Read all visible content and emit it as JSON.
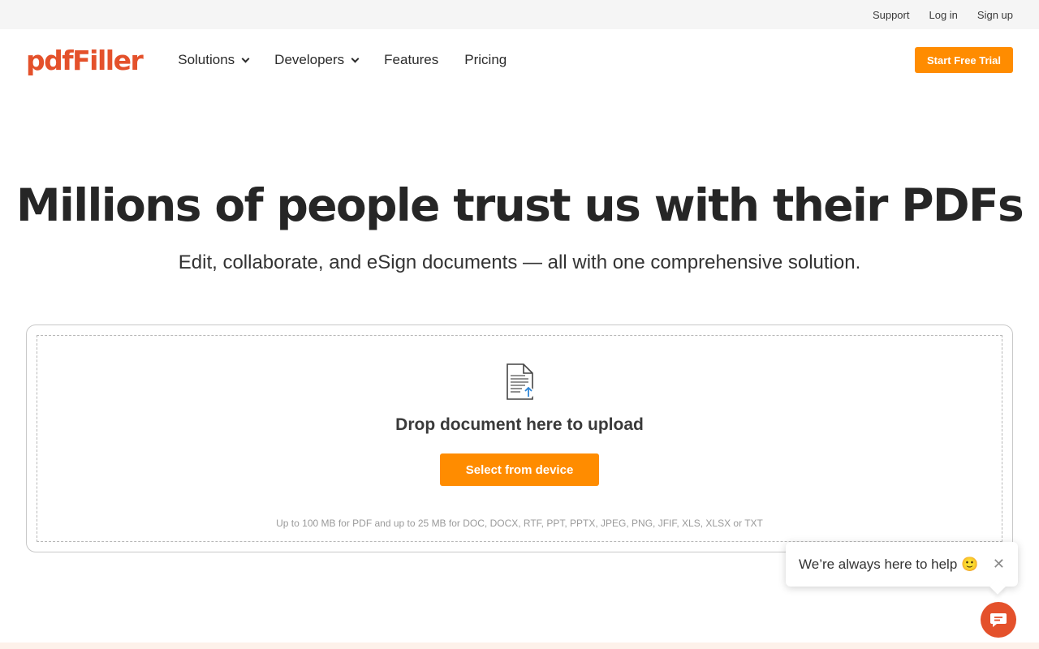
{
  "topbar": {
    "links": [
      "Support",
      "Log in",
      "Sign up"
    ]
  },
  "nav": {
    "logo": "pdfFiller",
    "items": [
      "Solutions",
      "Developers",
      "Features",
      "Pricing"
    ],
    "cta": "Start Free Trial"
  },
  "hero": {
    "title": "Millions of people trust us with their PDFs",
    "subtitle": "Edit, collaborate, and eSign documents — all with one comprehensive solution."
  },
  "upload": {
    "icon": "document-upload-icon",
    "drop_text": "Drop document here to upload",
    "button": "Select from device",
    "limits": "Up to 100 MB for PDF and up to 25 MB for DOC, DOCX, RTF, PPT, PPTX, JPEG, PNG, JFIF, XLS, XLSX or TXT"
  },
  "help": {
    "text": "We’re always here to help 🙂",
    "close": "✕",
    "chat_icon": "chat-icon"
  },
  "colors": {
    "brand": "#e4512b",
    "accent": "#ff8c00",
    "topbar_bg": "#f5f5f5"
  }
}
